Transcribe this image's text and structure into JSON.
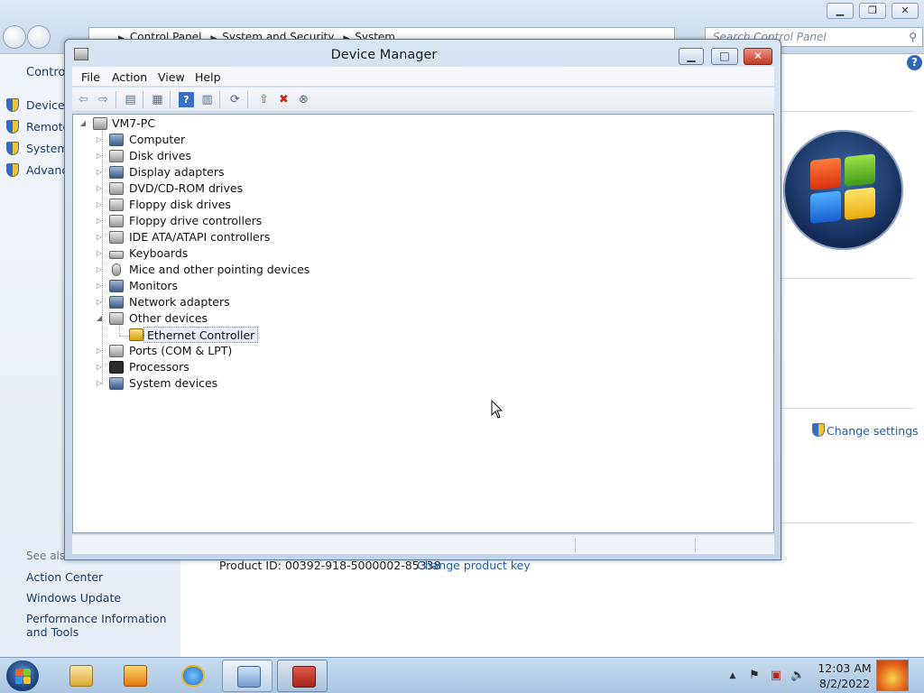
{
  "background_window": {
    "breadcrumb": [
      "Control Panel",
      "System and Security",
      "System"
    ],
    "search_placeholder": "Search Control Panel",
    "left_pane": {
      "home": "Control",
      "links": [
        "Device M",
        "Remote",
        "System",
        "Advanc"
      ],
      "see_also": "See also",
      "bottom_links": [
        "Action Center",
        "Windows Update",
        "Performance Information and Tools"
      ]
    },
    "change_settings": "Change settings",
    "product_id": "Product ID: 00392-918-5000002-85338",
    "change_product_key": "Change product key",
    "help_glyph": "?"
  },
  "device_manager": {
    "title": "Device Manager",
    "controls": {
      "minimize": "▁",
      "maximize": "□",
      "close": "✕"
    },
    "menu": [
      "File",
      "Action",
      "View",
      "Help"
    ],
    "toolbar_icons": [
      "back-icon",
      "forward-icon",
      "up-icon",
      "properties-icon",
      "help-icon",
      "console-icon",
      "scan-icon",
      "update-driver-icon",
      "disable-icon",
      "uninstall-icon"
    ],
    "tree": {
      "root": "VM7-PC",
      "categories": [
        {
          "label": "Computer",
          "icon": "computer-icon"
        },
        {
          "label": "Disk drives",
          "icon": "disk-drive-icon"
        },
        {
          "label": "Display adapters",
          "icon": "display-adapter-icon"
        },
        {
          "label": "DVD/CD-ROM drives",
          "icon": "dvd-drive-icon"
        },
        {
          "label": "Floppy disk drives",
          "icon": "floppy-drive-icon"
        },
        {
          "label": "Floppy drive controllers",
          "icon": "floppy-controller-icon"
        },
        {
          "label": "IDE ATA/ATAPI controllers",
          "icon": "ide-controller-icon"
        },
        {
          "label": "Keyboards",
          "icon": "keyboard-icon"
        },
        {
          "label": "Mice and other pointing devices",
          "icon": "mouse-icon"
        },
        {
          "label": "Monitors",
          "icon": "monitor-icon"
        },
        {
          "label": "Network adapters",
          "icon": "network-adapter-icon"
        },
        {
          "label": "Other devices",
          "icon": "other-devices-icon",
          "expanded": true,
          "children": [
            {
              "label": "Ethernet Controller",
              "icon": "warning-device-icon",
              "selected": true
            }
          ]
        },
        {
          "label": "Ports (COM & LPT)",
          "icon": "port-icon"
        },
        {
          "label": "Processors",
          "icon": "processor-icon"
        },
        {
          "label": "System devices",
          "icon": "system-device-icon"
        }
      ]
    }
  },
  "taskbar": {
    "apps": [
      "windows-explorer",
      "media-player",
      "internet-explorer",
      "control-panel",
      "device-manager"
    ],
    "clock_time": "12:03 AM",
    "clock_date": "8/2/2022"
  },
  "colors": {
    "link": "#1f5ea8",
    "titlebar": "#c6d6e9",
    "close_button": "#c33a22",
    "taskbar": "#a9c4e0"
  }
}
